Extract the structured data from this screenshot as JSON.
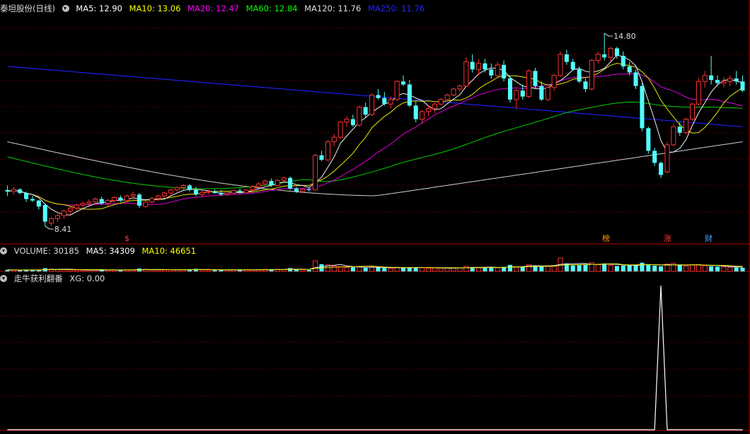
{
  "main_panel": {
    "title": "泰坦股份(日线)",
    "ma_labels": [
      {
        "text": "MA5: 12.90",
        "color": "#ffffff"
      },
      {
        "text": "MA10: 13.06",
        "color": "#ffff00"
      },
      {
        "text": "MA20: 12.47",
        "color": "#ff00ff"
      },
      {
        "text": "MA60: 12.84",
        "color": "#00ff00"
      },
      {
        "text": "MA120: 11.76",
        "color": "#dddddd"
      },
      {
        "text": "MA250: 11.76",
        "color": "#0000ff"
      }
    ],
    "high_label": "14.80",
    "low_label": "8.41",
    "badges": [
      {
        "text": "$",
        "color": "#ff3b3b"
      },
      {
        "text": "榜",
        "color": "#ff9900"
      },
      {
        "text": "涨",
        "color": "#ff3b3b"
      },
      {
        "text": "财",
        "color": "#4fa3ff"
      }
    ]
  },
  "volume_panel": {
    "labels": [
      {
        "text": "VOLUME: 30185",
        "color": "#dddddd"
      },
      {
        "text": "MA5: 34309",
        "color": "#ffffff"
      },
      {
        "text": "MA10: 46651",
        "color": "#ffff00"
      }
    ]
  },
  "indicator_panel": {
    "labels": [
      {
        "text": "走牛获利翻番",
        "color": "#dddddd"
      },
      {
        "text": "XG: 0.00",
        "color": "#dddddd"
      }
    ]
  },
  "colors": {
    "up": "#ff3232",
    "down": "#54ffff",
    "grid": "#7a0000",
    "border": "#b00000"
  },
  "chart_data": {
    "type": "candlestick",
    "ohlc": [
      [
        9.6,
        9.75,
        9.4,
        9.55
      ],
      [
        9.55,
        9.7,
        9.45,
        9.62
      ],
      [
        9.62,
        9.66,
        9.45,
        9.5
      ],
      [
        9.5,
        9.55,
        9.2,
        9.3
      ],
      [
        9.3,
        9.4,
        9.2,
        9.25
      ],
      [
        9.25,
        9.28,
        8.95,
        9.05
      ],
      [
        9.1,
        9.15,
        8.4,
        8.55
      ],
      [
        8.5,
        8.7,
        8.41,
        8.65
      ],
      [
        8.65,
        8.8,
        8.55,
        8.75
      ],
      [
        8.75,
        8.95,
        8.65,
        8.9
      ],
      [
        8.9,
        9.05,
        8.8,
        9.0
      ],
      [
        9.0,
        9.15,
        8.9,
        9.1
      ],
      [
        9.1,
        9.22,
        9.0,
        9.15
      ],
      [
        9.15,
        9.28,
        9.08,
        9.2
      ],
      [
        9.2,
        9.35,
        9.12,
        9.3
      ],
      [
        9.3,
        9.38,
        9.1,
        9.15
      ],
      [
        9.15,
        9.3,
        9.05,
        9.25
      ],
      [
        9.25,
        9.4,
        9.18,
        9.35
      ],
      [
        9.35,
        9.42,
        9.2,
        9.25
      ],
      [
        9.25,
        9.45,
        9.2,
        9.4
      ],
      [
        9.4,
        9.55,
        9.3,
        9.45
      ],
      [
        9.45,
        9.5,
        9.0,
        9.08
      ],
      [
        9.05,
        9.25,
        9.0,
        9.2
      ],
      [
        9.2,
        9.38,
        9.15,
        9.32
      ],
      [
        9.32,
        9.45,
        9.25,
        9.4
      ],
      [
        9.4,
        9.55,
        9.35,
        9.5
      ],
      [
        9.5,
        9.65,
        9.42,
        9.6
      ],
      [
        9.6,
        9.72,
        9.55,
        9.68
      ],
      [
        9.68,
        9.8,
        9.6,
        9.75
      ],
      [
        9.75,
        9.8,
        9.55,
        9.6
      ],
      [
        9.6,
        9.7,
        9.4,
        9.45
      ],
      [
        9.45,
        9.58,
        9.38,
        9.52
      ],
      [
        9.52,
        9.6,
        9.45,
        9.55
      ],
      [
        9.55,
        9.62,
        9.48,
        9.5
      ],
      [
        9.5,
        9.6,
        9.4,
        9.45
      ],
      [
        9.45,
        9.55,
        9.4,
        9.5
      ],
      [
        9.5,
        9.62,
        9.45,
        9.58
      ],
      [
        9.58,
        9.65,
        9.48,
        9.52
      ],
      [
        9.52,
        9.62,
        9.5,
        9.6
      ],
      [
        9.6,
        9.75,
        9.55,
        9.7
      ],
      [
        9.7,
        9.85,
        9.65,
        9.8
      ],
      [
        9.8,
        9.95,
        9.75,
        9.9
      ],
      [
        9.9,
        9.98,
        9.7,
        9.75
      ],
      [
        9.75,
        9.95,
        9.72,
        9.92
      ],
      [
        9.92,
        10.05,
        9.85,
        10.0
      ],
      [
        10.0,
        10.05,
        9.6,
        9.65
      ],
      [
        9.65,
        9.7,
        9.5,
        9.55
      ],
      [
        9.55,
        9.65,
        9.5,
        9.62
      ],
      [
        9.62,
        9.7,
        9.55,
        9.6
      ],
      [
        9.6,
        10.8,
        9.6,
        10.75
      ],
      [
        10.75,
        10.9,
        10.55,
        10.6
      ],
      [
        10.6,
        11.25,
        10.55,
        11.2
      ],
      [
        11.2,
        11.45,
        11.05,
        11.35
      ],
      [
        11.35,
        11.9,
        11.3,
        11.85
      ],
      [
        11.85,
        12.05,
        11.7,
        11.95
      ],
      [
        11.95,
        12.1,
        11.7,
        11.75
      ],
      [
        11.75,
        12.4,
        11.7,
        12.35
      ],
      [
        12.35,
        12.5,
        12.0,
        12.1
      ],
      [
        12.1,
        12.8,
        12.05,
        12.75
      ],
      [
        12.75,
        12.95,
        12.6,
        12.65
      ],
      [
        12.65,
        12.85,
        12.4,
        12.45
      ],
      [
        12.45,
        12.7,
        12.3,
        12.6
      ],
      [
        12.6,
        13.25,
        12.55,
        13.2
      ],
      [
        13.2,
        13.4,
        13.05,
        13.1
      ],
      [
        13.1,
        13.25,
        12.35,
        12.4
      ],
      [
        12.4,
        12.55,
        11.85,
        11.95
      ],
      [
        11.95,
        12.25,
        11.8,
        12.2
      ],
      [
        12.2,
        12.4,
        12.05,
        12.3
      ],
      [
        12.3,
        12.5,
        12.15,
        12.45
      ],
      [
        12.45,
        12.65,
        12.4,
        12.6
      ],
      [
        12.6,
        12.8,
        12.55,
        12.75
      ],
      [
        12.75,
        13.0,
        12.7,
        12.95
      ],
      [
        12.95,
        13.1,
        12.85,
        13.05
      ],
      [
        13.05,
        14.0,
        13.0,
        13.85
      ],
      [
        13.85,
        14.1,
        13.5,
        13.6
      ],
      [
        13.6,
        13.95,
        13.4,
        13.8
      ],
      [
        13.8,
        13.95,
        13.5,
        13.6
      ],
      [
        13.6,
        13.8,
        13.3,
        13.4
      ],
      [
        13.4,
        13.85,
        13.35,
        13.75
      ],
      [
        13.75,
        13.9,
        13.2,
        13.3
      ],
      [
        13.3,
        13.4,
        12.5,
        12.6
      ],
      [
        12.6,
        12.95,
        12.3,
        12.9
      ],
      [
        12.9,
        13.1,
        12.6,
        12.7
      ],
      [
        12.7,
        13.6,
        12.65,
        13.55
      ],
      [
        13.55,
        13.65,
        12.95,
        13.05
      ],
      [
        13.05,
        13.2,
        12.55,
        12.6
      ],
      [
        12.6,
        13.1,
        12.55,
        13.0
      ],
      [
        13.0,
        13.45,
        12.9,
        13.4
      ],
      [
        13.4,
        14.2,
        13.35,
        14.1
      ],
      [
        14.1,
        14.25,
        13.75,
        13.85
      ],
      [
        13.85,
        13.95,
        13.55,
        13.6
      ],
      [
        13.6,
        13.7,
        13.15,
        13.2
      ],
      [
        13.2,
        13.3,
        12.85,
        12.95
      ],
      [
        12.95,
        13.95,
        12.9,
        13.9
      ],
      [
        13.9,
        14.2,
        13.8,
        14.1
      ],
      [
        14.1,
        14.8,
        13.9,
        14.0
      ],
      [
        14.0,
        14.35,
        13.85,
        14.3
      ],
      [
        14.3,
        14.35,
        13.95,
        14.05
      ],
      [
        14.05,
        14.2,
        13.6,
        13.7
      ],
      [
        13.7,
        13.85,
        13.4,
        13.5
      ],
      [
        13.5,
        13.6,
        12.95,
        13.05
      ],
      [
        13.05,
        13.15,
        11.55,
        11.65
      ],
      [
        11.65,
        11.7,
        10.8,
        10.9
      ],
      [
        10.9,
        11.0,
        10.4,
        10.5
      ],
      [
        10.5,
        10.55,
        10.0,
        10.1
      ],
      [
        10.2,
        11.2,
        10.15,
        11.1
      ],
      [
        11.1,
        11.8,
        11.05,
        11.7
      ],
      [
        11.7,
        11.85,
        11.4,
        11.5
      ],
      [
        11.5,
        12.0,
        11.45,
        11.95
      ],
      [
        11.95,
        12.5,
        11.9,
        12.45
      ],
      [
        12.45,
        13.3,
        12.4,
        13.2
      ],
      [
        13.2,
        13.55,
        13.0,
        13.4
      ],
      [
        13.4,
        14.05,
        13.1,
        13.25
      ],
      [
        13.25,
        13.4,
        13.05,
        13.15
      ],
      [
        13.15,
        13.35,
        13.0,
        13.2
      ],
      [
        13.2,
        13.4,
        13.05,
        13.3
      ],
      [
        13.3,
        13.55,
        13.1,
        13.2
      ],
      [
        13.2,
        13.4,
        12.85,
        12.9
      ]
    ],
    "volume": [
      22,
      18,
      19,
      24,
      20,
      21,
      45,
      33,
      28,
      25,
      21,
      20,
      19,
      18,
      20,
      22,
      19,
      21,
      20,
      22,
      23,
      40,
      28,
      22,
      20,
      23,
      25,
      22,
      24,
      30,
      35,
      22,
      20,
      19,
      21,
      20,
      23,
      22,
      21,
      24,
      26,
      28,
      30,
      27,
      29,
      45,
      30,
      22,
      20,
      145,
      100,
      90,
      75,
      65,
      55,
      58,
      60,
      50,
      62,
      55,
      48,
      45,
      55,
      52,
      58,
      56,
      50,
      46,
      48,
      45,
      47,
      50,
      48,
      70,
      60,
      52,
      55,
      58,
      50,
      62,
      90,
      60,
      70,
      95,
      78,
      72,
      68,
      80,
      185,
      110,
      82,
      85,
      90,
      120,
      95,
      110,
      85,
      75,
      80,
      82,
      90,
      120,
      95,
      80,
      70,
      100,
      110,
      85,
      75,
      90,
      95,
      80,
      72,
      65,
      60,
      58,
      55,
      50
    ],
    "ylim": [
      8.0,
      15.2
    ],
    "xg": {
      "spike_index": 104,
      "value_before": 0.0,
      "spike_value": 1.0
    }
  }
}
